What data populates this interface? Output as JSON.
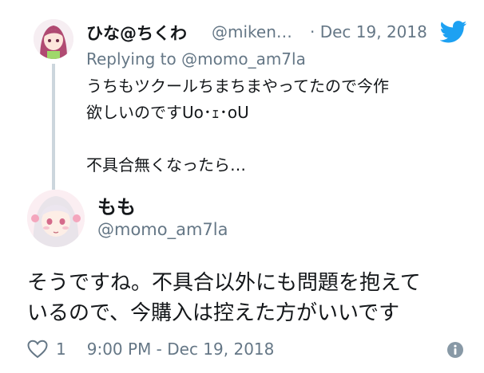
{
  "reply": {
    "display_name": "ひな@ちくわ",
    "handle": "@miken…",
    "date": "· Dec 19, 2018",
    "replying_prefix": "Replying to",
    "replying_to": "@momo_am7la",
    "text_line1": "うちもツクールちまちまやってたので今作",
    "text_line2": "欲しいのですUo･ｪ･oU",
    "text_line3": "不具合無くなったら…"
  },
  "main": {
    "display_name": "もも",
    "handle": "@momo_am7la",
    "text_line1": "そうですね。不具合以外にも問題を抱えて",
    "text_line2": "いるので、今購入は控えた方がいいです",
    "likes": "1",
    "timestamp": "9:00 PM - Dec 19, 2018"
  },
  "colors": {
    "twitter_blue": "#1da1f2",
    "muted_text": "#657786",
    "thread_line": "#ccd6dd"
  },
  "icons": {
    "brand": "twitter-bird-icon",
    "like": "heart-icon",
    "info": "info-icon"
  }
}
